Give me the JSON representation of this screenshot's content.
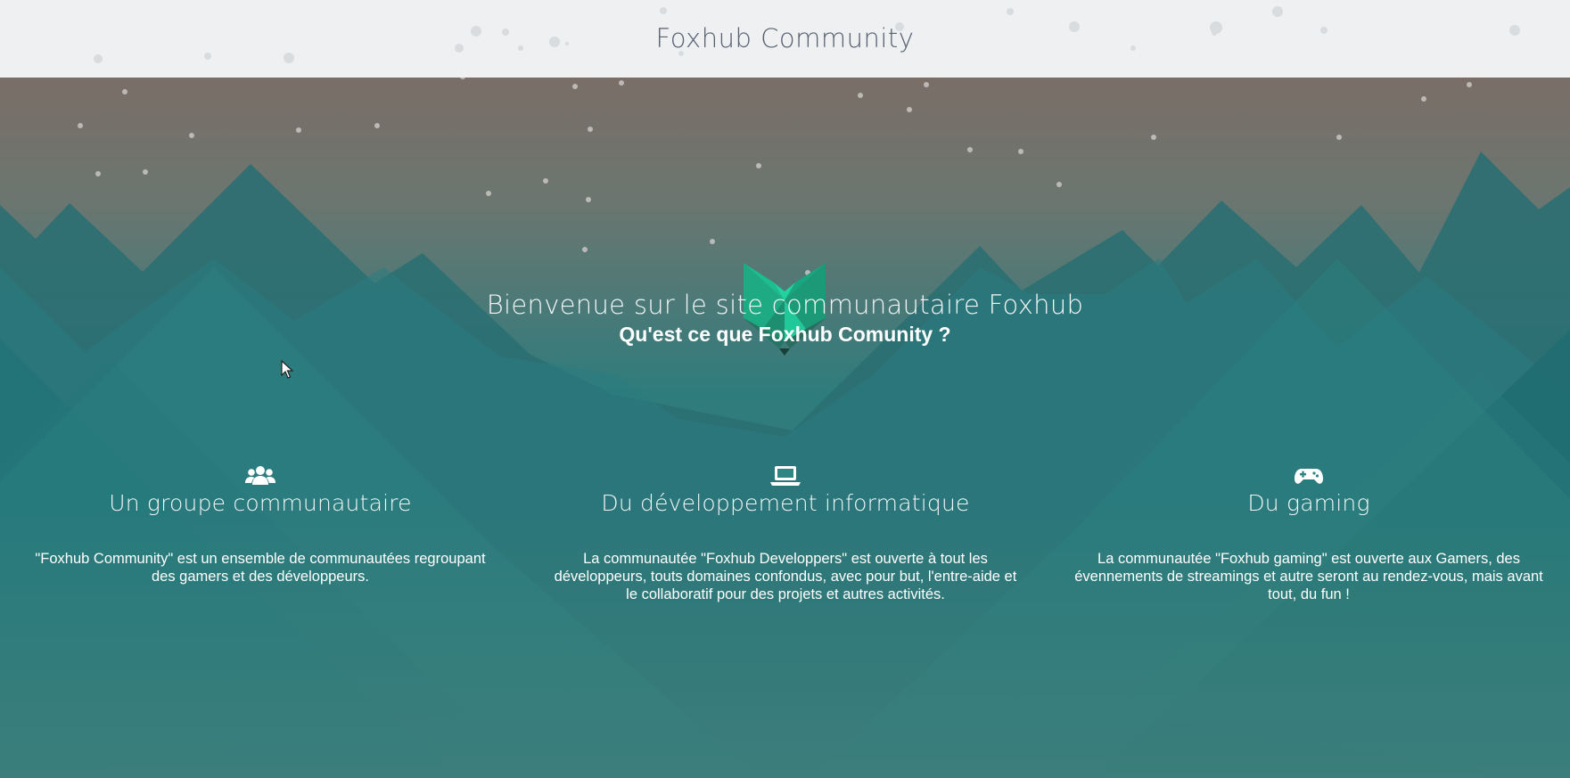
{
  "header": {
    "title": "Foxhub Community"
  },
  "hero": {
    "welcome": "Bienvenue sur le site communautaire Foxhub",
    "question": "Qu'est ce que Foxhub Comunity ?"
  },
  "features": [
    {
      "icon": "users-icon",
      "title": "Un groupe communautaire",
      "text": "\"Foxhub Community\" est un ensemble de communautées regroupant des gamers et des développeurs."
    },
    {
      "icon": "laptop-icon",
      "title": "Du développement informatique",
      "text": "La communautée \"Foxhub Developpers\" est ouverte à tout les développeurs, touts domaines confondus, avec pour but, l'entre-aide et le collaboratif pour des projets et autres activités."
    },
    {
      "icon": "gamepad-icon",
      "title": "Du gaming",
      "text": "La communautée \"Foxhub gaming\" est ouverte aux Gamers, des évennements de streamings et autre seront au rendez-vous, mais avant tout, du fun !"
    }
  ],
  "colors": {
    "header_bg": "#eef0f1",
    "sky_top": "#7a6e67",
    "sky_mid": "#2e7c7c",
    "mountain_dark": "#1f6b6e",
    "logo_green": "#21c99a"
  }
}
